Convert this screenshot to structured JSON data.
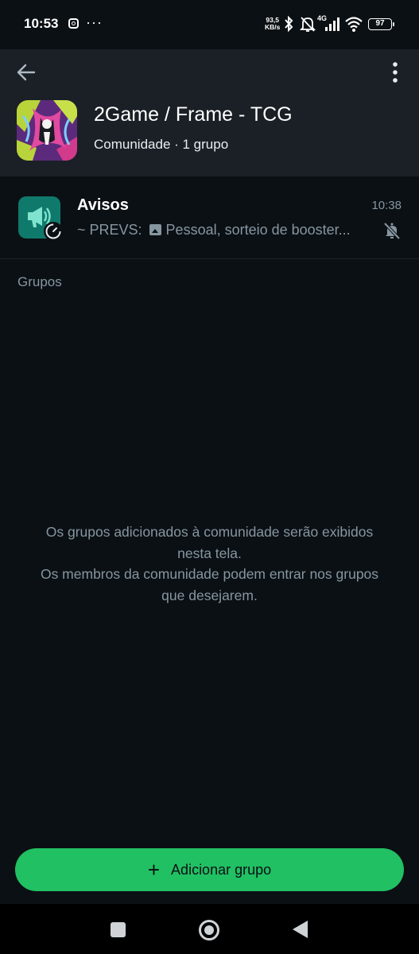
{
  "status_bar": {
    "time": "10:53",
    "speed_value": "93,5",
    "speed_unit": "KB/s",
    "network": "4G",
    "battery": "97",
    "icons": [
      "instagram-icon",
      "more-notifications-icon",
      "bluetooth-icon",
      "notifications-off-icon",
      "signal-icon",
      "wifi-icon",
      "battery-icon"
    ]
  },
  "header": {
    "title": "2Game / Frame - TCG",
    "subtitle": "Comunidade · 1 grupo"
  },
  "announcements": {
    "title": "Avisos",
    "time": "10:38",
    "sender": "~ PREVS:",
    "preview": "Pessoal, sorteio de booster..."
  },
  "groups_section": {
    "label": "Grupos",
    "empty_line1": "Os grupos adicionados à comunidade serão exibidos",
    "empty_line2": "nesta tela.",
    "empty_line3": "Os membros da comunidade podem entrar nos grupos",
    "empty_line4": "que desejarem."
  },
  "actions": {
    "add_group_label": "Adicionar grupo"
  },
  "colors": {
    "accent": "#21c063",
    "header_bg": "#1a2026",
    "background": "#0b1014",
    "announce_icon_bg": "#0f7a6c"
  }
}
